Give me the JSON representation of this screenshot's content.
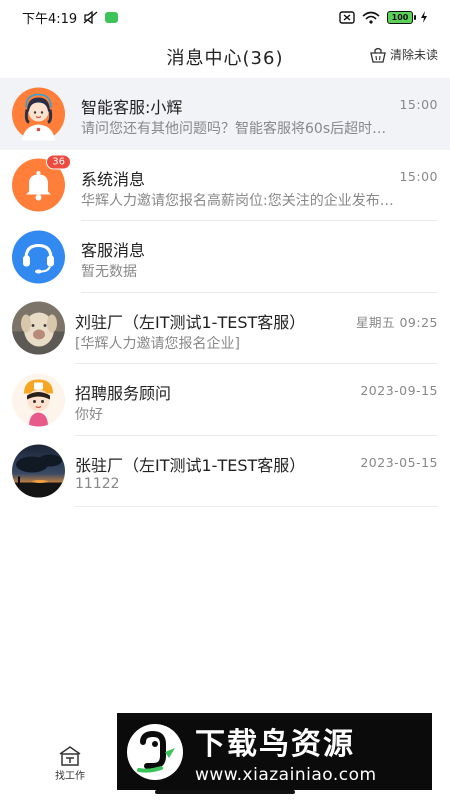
{
  "status_bar": {
    "time": "下午4:19",
    "battery": "100"
  },
  "header": {
    "title": "消息中心(36)",
    "clear_label": "清除未读"
  },
  "messages": [
    {
      "name": "智能客服:小辉",
      "time": "15:00",
      "preview": "请问您还有其他问题吗？智能客服将60s后超时…"
    },
    {
      "name": "系统消息",
      "time": "15:00",
      "preview": "华辉人力邀请您报名高薪岗位:您关注的企业发布…",
      "badge": "36"
    },
    {
      "name": "客服消息",
      "time": "",
      "preview": "暂无数据"
    },
    {
      "name": "刘驻厂（左IT测试1-TEST客服）",
      "time": "星期五 09:25",
      "preview": "[华辉人力邀请您报名企业]"
    },
    {
      "name": "招聘服务顾问",
      "time": "2023-09-15",
      "preview": "你好"
    },
    {
      "name": "张驻厂（左IT测试1-TEST客服）",
      "time": "2023-05-15",
      "preview": "11122"
    }
  ],
  "tabbar": {
    "tab_jobs": "找工作"
  },
  "watermark": {
    "title": "下载鸟资源",
    "url": "www.xiazainiao.com"
  },
  "colors": {
    "badge": "#ec4b3d",
    "orange_avatar": "#ff7e3a",
    "blue_avatar": "#3289f0",
    "active_row": "#f2f3f7"
  }
}
